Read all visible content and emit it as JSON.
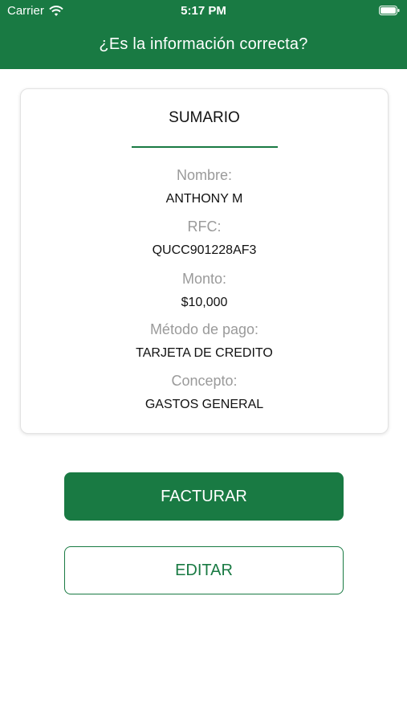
{
  "status_bar": {
    "carrier": "Carrier",
    "time": "5:17 PM"
  },
  "header": {
    "title": "¿Es la información correcta?"
  },
  "summary": {
    "title": "SUMARIO",
    "fields": [
      {
        "label": "Nombre:",
        "value": "ANTHONY M"
      },
      {
        "label": "RFC:",
        "value": "QUCC901228AF3"
      },
      {
        "label": "Monto:",
        "value": "$10,000"
      },
      {
        "label": "Método de pago:",
        "value": "TARJETA DE CREDITO"
      },
      {
        "label": "Concepto:",
        "value": "GASTOS GENERAL"
      }
    ]
  },
  "actions": {
    "primary_label": "FACTURAR",
    "secondary_label": "EDITAR"
  },
  "colors": {
    "brand_green": "#197a43",
    "label_gray": "#9a9a9a"
  }
}
